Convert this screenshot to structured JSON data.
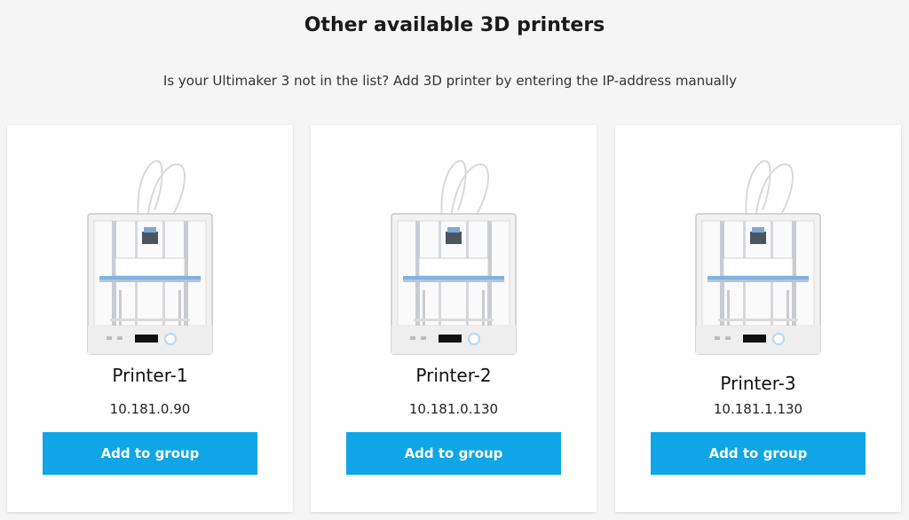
{
  "header": {
    "title": "Other available 3D printers",
    "subtitle": "Is your Ultimaker 3 not in the list?  Add 3D printer by entering the IP-address manually"
  },
  "colors": {
    "accent": "#10a5e6",
    "card": "#ffffff",
    "background": "#f5f5f5"
  },
  "printers": [
    {
      "name": "Printer-1",
      "ip": "10.181.0.90",
      "button_label": "Add to group",
      "image_brand": "Ultimaker"
    },
    {
      "name": "Printer-2",
      "ip": "10.181.0.130",
      "button_label": "Add to group",
      "image_brand": "Ultimaker"
    },
    {
      "name": "Printer-3",
      "ip": "10.181.1.130",
      "button_label": "Add to group",
      "image_brand": "Ultimaker"
    }
  ]
}
